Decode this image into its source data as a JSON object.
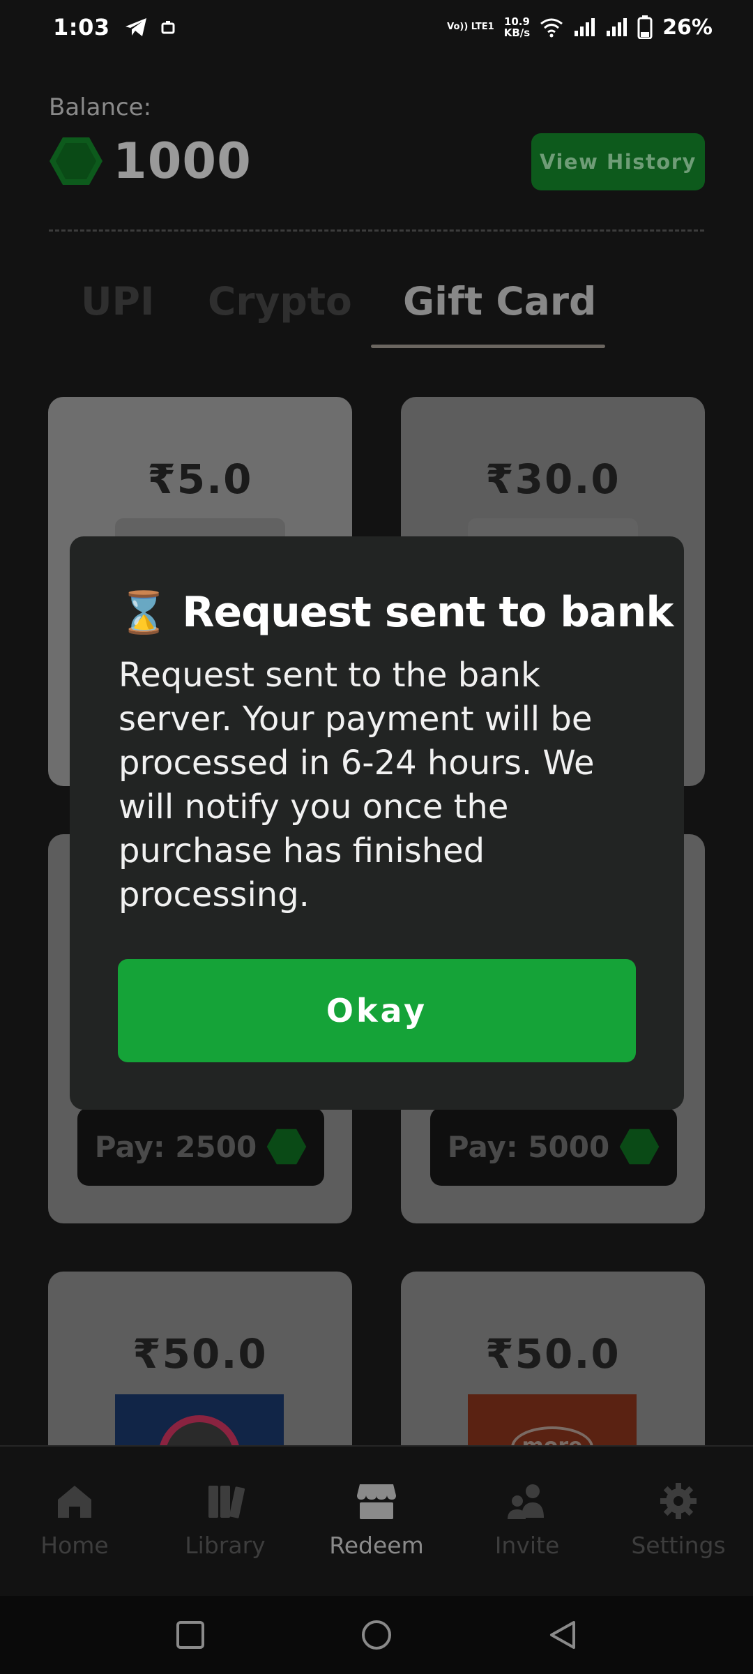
{
  "status_bar": {
    "time": "1:03",
    "network_top": "Vo)) LTE1",
    "speed_value": "10.9",
    "speed_unit": "KB/s",
    "battery": "26%"
  },
  "balance": {
    "label": "Balance:",
    "value": "1000",
    "history_button": "View History"
  },
  "tabs": [
    {
      "label": "UPI"
    },
    {
      "label": "Crypto"
    },
    {
      "label": "Gift Card",
      "active": true
    }
  ],
  "cards": [
    {
      "price": "₹5.0"
    },
    {
      "price": "₹30.0"
    },
    {
      "pay": "Pay: 2500"
    },
    {
      "pay": "Pay: 5000"
    },
    {
      "price": "₹50.0",
      "logo_text": ""
    },
    {
      "price": "₹50.0",
      "logo_text": "more"
    }
  ],
  "dialog": {
    "icon": "⌛",
    "title": "Request sent to bank",
    "body": "Request sent to the bank server. Your payment will be processed in 6-24 hours. We will notify you once the purchase has finished processing.",
    "button": "Okay"
  },
  "nav": [
    {
      "label": "Home",
      "icon": "home-icon"
    },
    {
      "label": "Library",
      "icon": "library-icon"
    },
    {
      "label": "Redeem",
      "icon": "store-icon",
      "active": true
    },
    {
      "label": "Invite",
      "icon": "invite-icon"
    },
    {
      "label": "Settings",
      "icon": "gear-icon"
    }
  ],
  "colors": {
    "accent_green": "#15a338",
    "dialog_bg": "#222423",
    "background": "#121212"
  }
}
